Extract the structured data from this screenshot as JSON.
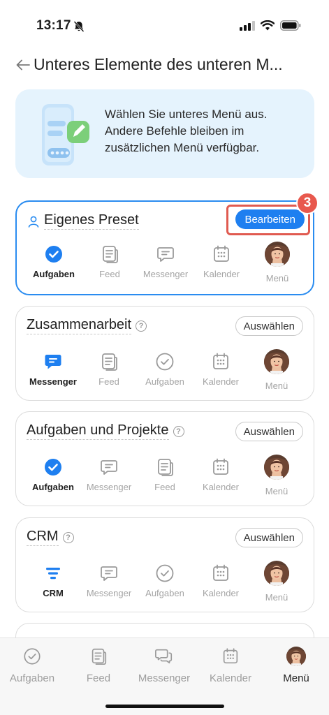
{
  "status_bar": {
    "time": "13:17"
  },
  "header": {
    "title": "Unteres Elemente des unteren M..."
  },
  "banner": {
    "text": "Wählen Sie unteres Menü aus. Andere Befehle bleiben im zusätzlichen Menü verfügbar."
  },
  "presets": [
    {
      "title": "Eigenes Preset",
      "action": "Bearbeiten",
      "step_badge": "3",
      "items": [
        "Aufgaben",
        "Feed",
        "Messenger",
        "Kalender",
        "Menü"
      ]
    },
    {
      "title": "Zusammenarbeit",
      "action": "Auswählen",
      "items": [
        "Messenger",
        "Feed",
        "Aufgaben",
        "Kalender",
        "Menü"
      ]
    },
    {
      "title": "Aufgaben und Projekte",
      "action": "Auswählen",
      "items": [
        "Aufgaben",
        "Messenger",
        "Feed",
        "Kalender",
        "Menü"
      ]
    },
    {
      "title": "CRM",
      "action": "Auswählen",
      "items": [
        "CRM",
        "Messenger",
        "Aufgaben",
        "Kalender",
        "Menü"
      ]
    }
  ],
  "bottom_nav": {
    "items": [
      "Aufgaben",
      "Feed",
      "Messenger",
      "Kalender",
      "Menü"
    ],
    "active": "Menü"
  },
  "colors": {
    "accent": "#1e7ff0",
    "highlight": "#e05a50",
    "banner_bg": "#e5f3fd"
  }
}
